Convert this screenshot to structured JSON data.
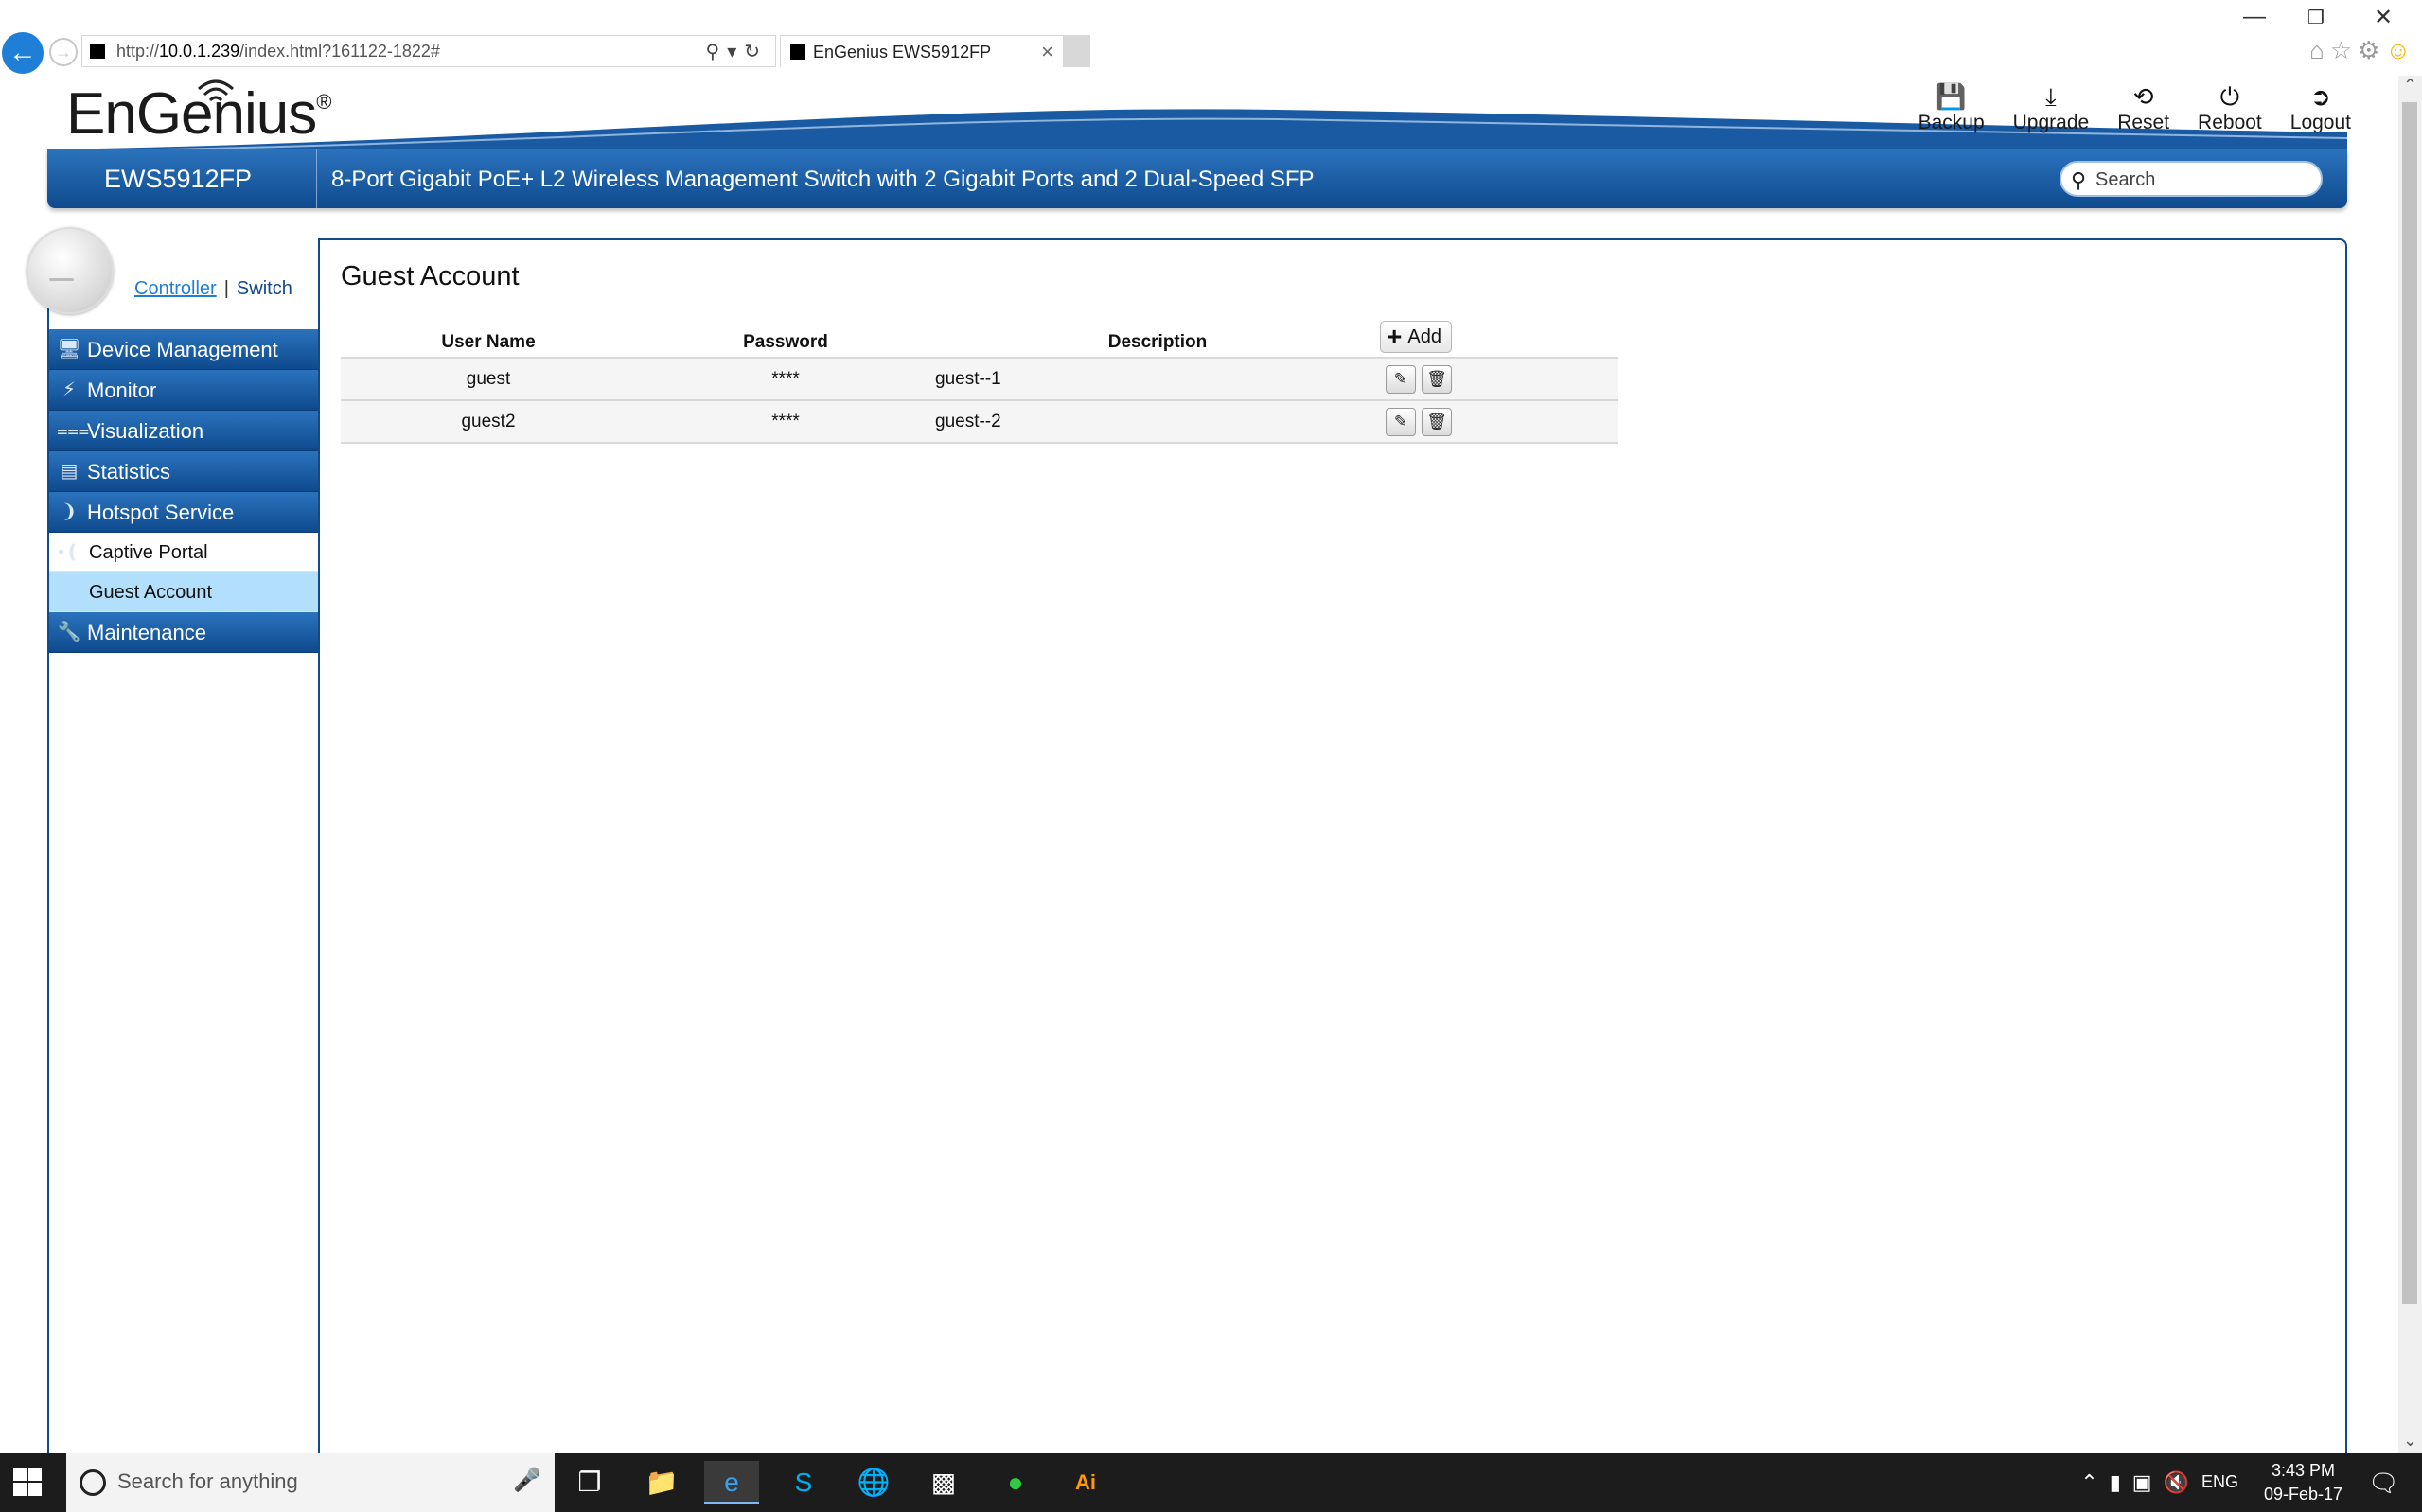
{
  "browser": {
    "address_url_prefix": "http://",
    "address_url_host": "10.0.1.239",
    "address_url_path": "/index.html?161122-1822#",
    "tab_title": "EnGenius EWS5912FP",
    "tab_close": "×"
  },
  "header": {
    "logo_text": "EnGenius",
    "logo_mark": "®",
    "model": "EWS5912FP",
    "description": "8-Port Gigabit PoE+ L2 Wireless Management Switch with 2 Gigabit Ports and 2 Dual-Speed SFP",
    "search_placeholder": "Search",
    "actions": [
      {
        "label": "Backup",
        "icon": "save-icon"
      },
      {
        "label": "Upgrade",
        "icon": "download-icon"
      },
      {
        "label": "Reset",
        "icon": "refresh-icon"
      },
      {
        "label": "Reboot",
        "icon": "power-icon"
      },
      {
        "label": "Logout",
        "icon": "logout-icon"
      }
    ]
  },
  "sidebar": {
    "mode_controller": "Controller",
    "mode_separator": "|",
    "mode_switch": "Switch",
    "items": [
      {
        "label": "Device Management",
        "icon": "devices-icon"
      },
      {
        "label": "Monitor",
        "icon": "monitor-icon"
      },
      {
        "label": "Visualization",
        "icon": "share-icon"
      },
      {
        "label": "Statistics",
        "icon": "chart-icon"
      },
      {
        "label": "Hotspot Service",
        "icon": "wireless-icon"
      },
      {
        "label": "Maintenance",
        "icon": "wrench-icon"
      }
    ],
    "sub_items": [
      {
        "label": "Captive Portal",
        "active": false
      },
      {
        "label": "Guest Account",
        "active": true
      }
    ]
  },
  "main": {
    "title": "Guest Account",
    "columns": [
      "User Name",
      "Password",
      "Description"
    ],
    "add_label": "Add",
    "rows": [
      {
        "user": "guest",
        "password": "****",
        "description": "guest--1"
      },
      {
        "user": "guest2",
        "password": "****",
        "description": "guest--2"
      }
    ]
  },
  "taskbar": {
    "search_placeholder": "Search for anything",
    "lang": "ENG",
    "time": "3:43 PM",
    "date": "09-Feb-17"
  },
  "colors": {
    "brand_blue": "#0f4a8d",
    "active_sub": "#b2dffb"
  }
}
